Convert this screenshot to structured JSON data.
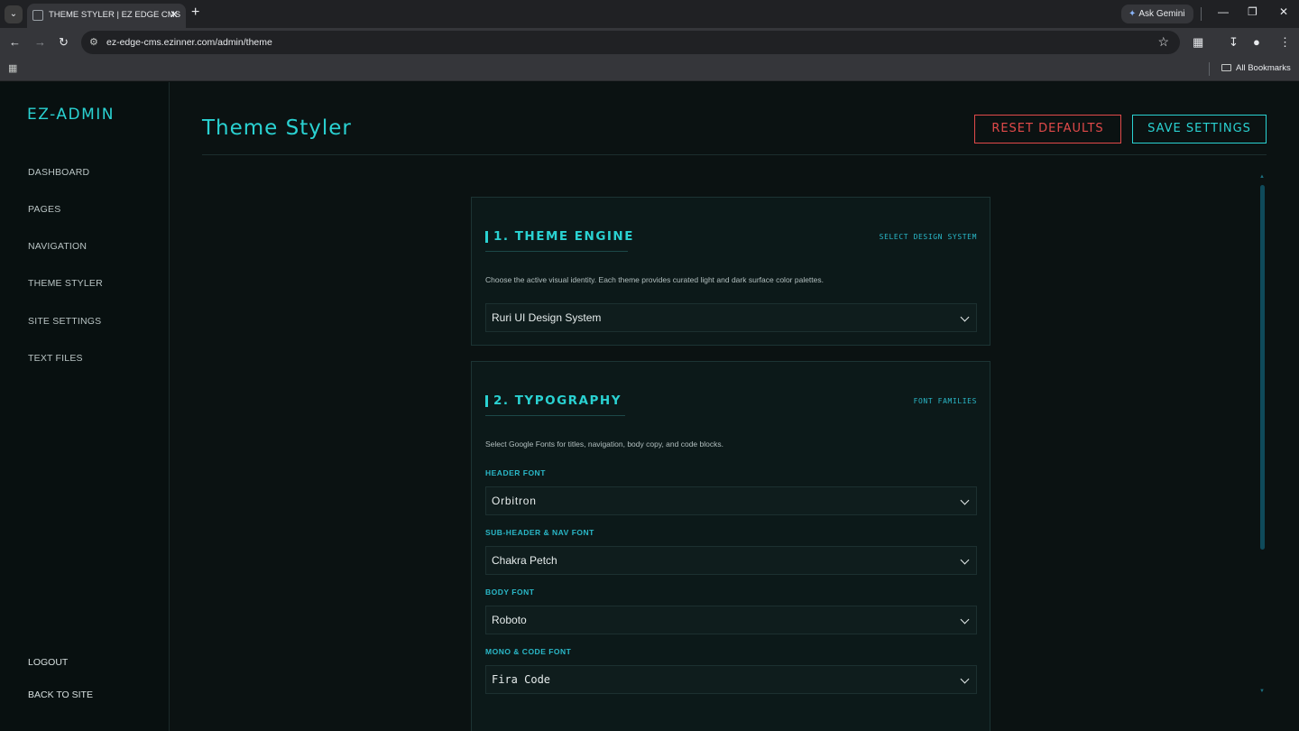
{
  "browser": {
    "tab_title": "THEME STYLER | EZ EDGE CMS",
    "url": "ez-edge-cms.ezinner.com/admin/theme",
    "ask_gemini": "Ask Gemini",
    "all_bookmarks": "All Bookmarks"
  },
  "sidebar": {
    "brand": "EZ-ADMIN",
    "items": [
      {
        "label": "DASHBOARD"
      },
      {
        "label": "PAGES"
      },
      {
        "label": "NAVIGATION"
      },
      {
        "label": "THEME STYLER"
      },
      {
        "label": "SITE SETTINGS"
      },
      {
        "label": "TEXT FILES"
      }
    ],
    "logout": "LOGOUT",
    "back_to_site": "BACK TO SITE"
  },
  "header": {
    "title": "Theme Styler",
    "reset_label": "RESET DEFAULTS",
    "save_label": "SAVE SETTINGS"
  },
  "theme_engine": {
    "title": "1. THEME ENGINE",
    "tag": "SELECT DESIGN SYSTEM",
    "description": "Choose the active visual identity. Each theme provides curated light and dark surface color palettes.",
    "selected": "Ruri UI Design System"
  },
  "typography": {
    "title": "2. TYPOGRAPHY",
    "tag": "FONT FAMILIES",
    "description": "Select Google Fonts for titles, navigation, body copy, and code blocks.",
    "header_font": {
      "label": "HEADER FONT",
      "value": "Orbitron"
    },
    "subheader_font": {
      "label": "SUB-HEADER & NAV FONT",
      "value": "Chakra Petch"
    },
    "body_font": {
      "label": "BODY FONT",
      "value": "Roboto"
    },
    "mono_font": {
      "label": "MONO & CODE FONT",
      "value": "Fira Code"
    }
  },
  "colors": {
    "accent": "#2ad2d2",
    "danger": "#e24a4a",
    "background": "#0b1212"
  }
}
